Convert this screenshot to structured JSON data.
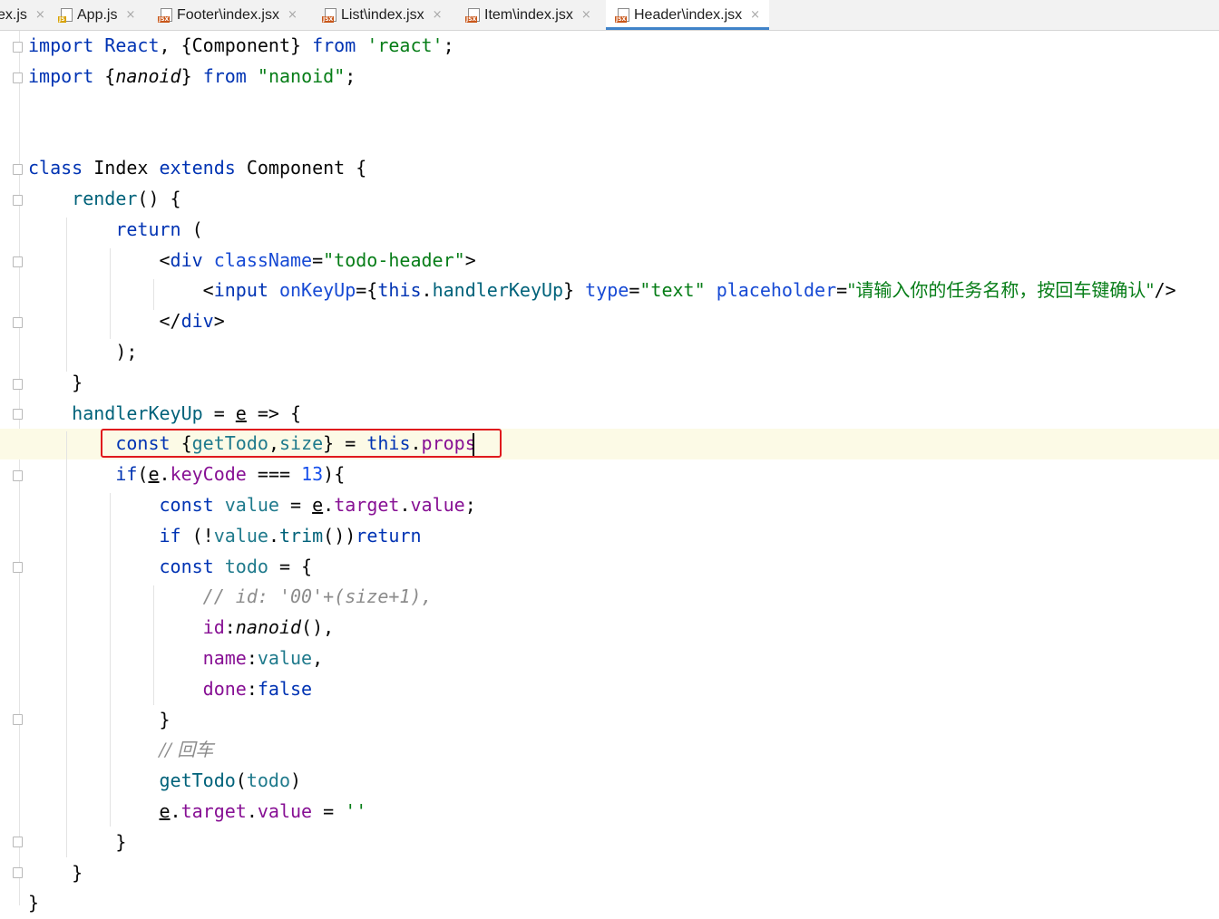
{
  "tabs": [
    {
      "label": "ex.js",
      "icon": "none"
    },
    {
      "label": "App.js",
      "icon": "js-file-icon"
    },
    {
      "label": "Footer\\index.jsx",
      "icon": "jsx-file-icon"
    },
    {
      "label": "List\\index.jsx",
      "icon": "jsx-file-icon"
    },
    {
      "label": "Item\\index.jsx",
      "icon": "jsx-file-icon"
    },
    {
      "label": "Header\\index.jsx",
      "icon": "jsx-file-icon",
      "active": true
    }
  ],
  "icon_badges": {
    "js": "JS",
    "jsx": "JSX"
  },
  "close_glyph": "×",
  "colors": {
    "keyword": "#0033b3",
    "string": "#067d17",
    "comment": "#8c8c8c",
    "accent": "#4083c9",
    "highlight_box": "#e0191d"
  },
  "editor": {
    "lines": [
      [
        [
          "import",
          "kw"
        ],
        [
          " "
        ],
        [
          "React",
          "kw"
        ],
        [
          ", {Component} "
        ],
        [
          "from",
          "kw"
        ],
        [
          " "
        ],
        [
          "'react'",
          "str"
        ],
        [
          ";"
        ]
      ],
      [
        [
          "import",
          "kw"
        ],
        [
          " {"
        ],
        [
          "nanoid",
          "ital"
        ],
        [
          "} "
        ],
        [
          "from",
          "kw"
        ],
        [
          " "
        ],
        [
          "\"nanoid\"",
          "str"
        ],
        [
          ";"
        ]
      ],
      [],
      [],
      [
        [
          "class",
          "kw"
        ],
        [
          " Index "
        ],
        [
          "extends",
          "kw"
        ],
        [
          " Component {"
        ]
      ],
      [
        [
          "    "
        ],
        [
          "render",
          "fn"
        ],
        [
          "() {"
        ]
      ],
      [
        [
          "        "
        ],
        [
          "return",
          "kw"
        ],
        [
          " ("
        ]
      ],
      [
        [
          "            "
        ],
        [
          "<"
        ],
        [
          "div",
          "kw"
        ],
        [
          " "
        ],
        [
          "className",
          "attr"
        ],
        [
          "="
        ],
        [
          "\"todo-header\"",
          "str"
        ],
        [
          ">"
        ]
      ],
      [
        [
          "                "
        ],
        [
          "<"
        ],
        [
          "input",
          "kw"
        ],
        [
          " "
        ],
        [
          "onKeyUp",
          "attr"
        ],
        [
          "={"
        ],
        [
          "this",
          "kw"
        ],
        [
          "."
        ],
        [
          "handlerKeyUp",
          "fn"
        ],
        [
          "} "
        ],
        [
          "type",
          "attr"
        ],
        [
          "="
        ],
        [
          "\"text\"",
          "str"
        ],
        [
          " "
        ],
        [
          "placeholder",
          "attr"
        ],
        [
          "="
        ],
        [
          "\"请输入你的任务名称，按回车键确认\"",
          "str cjk"
        ],
        [
          "/>"
        ]
      ],
      [
        [
          "            </"
        ],
        [
          "div",
          "kw"
        ],
        [
          ">"
        ]
      ],
      [
        [
          "        );"
        ]
      ],
      [
        [
          "    }"
        ]
      ],
      [
        [
          "    "
        ],
        [
          "handlerKeyUp",
          "fn"
        ],
        [
          " = "
        ],
        [
          "e",
          "ul"
        ],
        [
          " => {"
        ]
      ],
      [
        [
          "        "
        ],
        [
          "const",
          "kw"
        ],
        [
          " {"
        ],
        [
          "getTodo",
          "var"
        ],
        [
          ","
        ],
        [
          "size",
          "var"
        ],
        [
          "} = "
        ],
        [
          "this",
          "kw"
        ],
        [
          "."
        ],
        [
          "props",
          "prop"
        ]
      ],
      [
        [
          "        "
        ],
        [
          "if",
          "kw"
        ],
        [
          "("
        ],
        [
          "e",
          "ul"
        ],
        [
          "."
        ],
        [
          "keyCode",
          "prop"
        ],
        [
          " === "
        ],
        [
          "13",
          "num"
        ],
        [
          "){"
        ]
      ],
      [
        [
          "            "
        ],
        [
          "const",
          "kw"
        ],
        [
          " "
        ],
        [
          "value",
          "var"
        ],
        [
          " = "
        ],
        [
          "e",
          "ul"
        ],
        [
          "."
        ],
        [
          "target",
          "prop"
        ],
        [
          "."
        ],
        [
          "value",
          "prop"
        ],
        [
          ";"
        ]
      ],
      [
        [
          "            "
        ],
        [
          "if",
          "kw"
        ],
        [
          " (!"
        ],
        [
          "value",
          "var"
        ],
        [
          "."
        ],
        [
          "trim",
          "fn"
        ],
        [
          "())"
        ],
        [
          "return",
          "kw"
        ]
      ],
      [
        [
          "            "
        ],
        [
          "const",
          "kw"
        ],
        [
          " "
        ],
        [
          "todo",
          "var"
        ],
        [
          " = {"
        ]
      ],
      [
        [
          "                "
        ],
        [
          "// id: '00'+(size+1),",
          "cmt"
        ]
      ],
      [
        [
          "                "
        ],
        [
          "id",
          "prop"
        ],
        [
          ":"
        ],
        [
          "nanoid",
          "ital"
        ],
        [
          "(),"
        ]
      ],
      [
        [
          "                "
        ],
        [
          "name",
          "prop"
        ],
        [
          ":"
        ],
        [
          "value",
          "var"
        ],
        [
          ","
        ]
      ],
      [
        [
          "                "
        ],
        [
          "done",
          "prop"
        ],
        [
          ":"
        ],
        [
          "false",
          "kw"
        ]
      ],
      [
        [
          "            }"
        ]
      ],
      [
        [
          "            "
        ],
        [
          "// 回车",
          "cmt cjk"
        ]
      ],
      [
        [
          "            "
        ],
        [
          "getTodo",
          "fn"
        ],
        [
          "("
        ],
        [
          "todo",
          "var"
        ],
        [
          ")"
        ]
      ],
      [
        [
          "            "
        ],
        [
          "e",
          "ul"
        ],
        [
          "."
        ],
        [
          "target",
          "prop"
        ],
        [
          "."
        ],
        [
          "value",
          "prop"
        ],
        [
          " = "
        ],
        [
          "''",
          "str"
        ]
      ],
      [
        [
          "        }"
        ]
      ],
      [
        [
          "    }"
        ]
      ],
      [
        [
          "}"
        ]
      ]
    ]
  }
}
